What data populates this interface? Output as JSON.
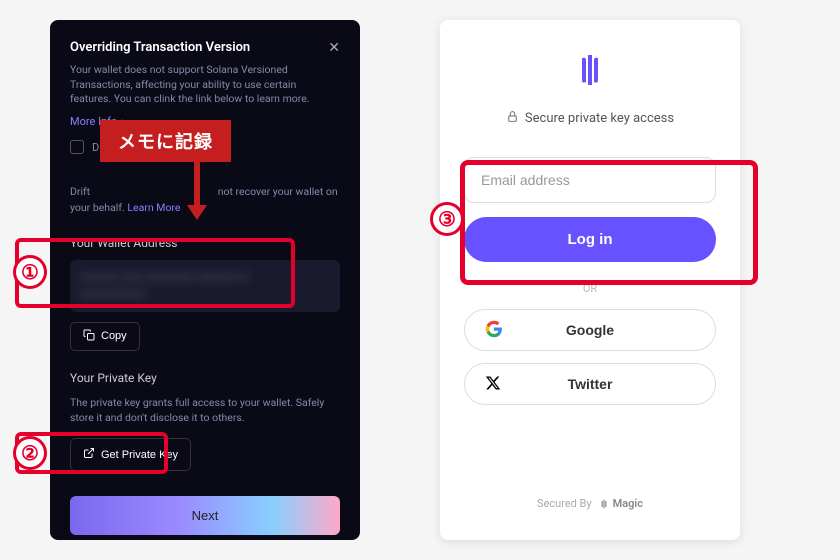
{
  "left": {
    "override_title": "Overriding Transaction Version",
    "override_desc": "Your wallet does not support Solana Versioned Transactions, affecting your ability to use certain features. You can clink the link below to learn more.",
    "more_info": "More Info",
    "drift_text_prefix": "Drift",
    "drift_text": "not recover your wallet on your behalf.",
    "learn_more": "Learn More",
    "wallet_label": "Your Wallet Address",
    "copy": "Copy",
    "private_key_label": "Your Private Key",
    "private_key_desc": "The private key grants full access to your wallet. Safely store it and don't disclose it to others.",
    "get_private_key": "Get Private Key",
    "next": "Next",
    "memo_badge": "メモに記録",
    "checkbox_label": "D"
  },
  "right": {
    "secure_text": "Secure private key access",
    "email_placeholder": "Email address",
    "login": "Log in",
    "or": "OR",
    "google": "Google",
    "twitter": "Twitter",
    "secured_by": "Secured By",
    "magic": "Magic"
  },
  "badges": {
    "one": "①",
    "two": "②",
    "three": "③"
  },
  "colors": {
    "accent_red": "#e4002b",
    "accent_purple": "#6851ff"
  }
}
